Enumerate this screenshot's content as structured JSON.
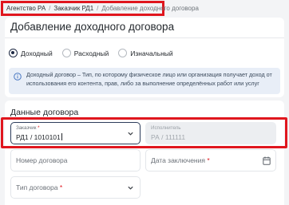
{
  "breadcrumb": {
    "items": [
      "Агентство РА",
      "Заказчик РД1",
      "Добавление доходного договора"
    ]
  },
  "page": {
    "title": "Добавление доходного договора"
  },
  "contract_kind": {
    "options": [
      "Доходный",
      "Расходный",
      "Изначальный"
    ],
    "selected": "Доходный"
  },
  "info": {
    "text": "Доходный договор – Тип, по которому физическое лицо или организация получает доход от использования его контента, прав, либо за выполнение определённых работ или услуг"
  },
  "section": {
    "title": "Данные договора"
  },
  "form": {
    "customer": {
      "label": "Заказчик",
      "value": "РД1 / 1010101"
    },
    "executor": {
      "label": "Исполнитель",
      "value": "РА / 111111"
    },
    "number": {
      "label": "Номер договора"
    },
    "date": {
      "label": "Дата заключения"
    },
    "type": {
      "label": "Тип договора"
    },
    "required_mark": "*"
  },
  "colors": {
    "highlight": "#e0161e",
    "info_bg": "#e8eef7",
    "accent": "#2d3e5c"
  },
  "icons": {
    "info": "info-icon",
    "chevron": "chevron-down-icon",
    "calendar": "calendar-icon"
  }
}
